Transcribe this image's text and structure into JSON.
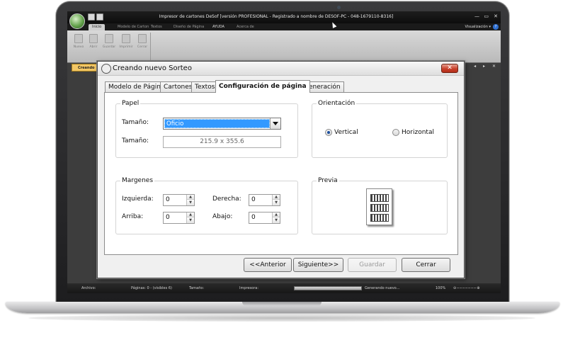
{
  "app": {
    "title": "Impresor de cartones DeSof [versión PROFESIONAL  - Registrado a nombre de DESOF-PC - 048-1679110-8316]",
    "window_controls": {
      "minimize": "—",
      "maximize": "▭",
      "close": "✕"
    }
  },
  "ribbon": {
    "tabs": [
      "Inicio",
      "Modelo de Carton",
      "Textos",
      "Diseño de Página",
      "AYUDA",
      "Acerca de"
    ],
    "active_tab": "Inicio",
    "visualizacion_label": "Visualización ▾",
    "help_label": "?",
    "buttons": [
      {
        "label": "Nuevo",
        "icon": "new-doc-icon"
      },
      {
        "label": "Abrir",
        "icon": "open-folder-icon"
      },
      {
        "label": "Guardar",
        "icon": "save-icon"
      },
      {
        "label": "Imprimir",
        "icon": "print-icon"
      },
      {
        "label": "Cerrar",
        "icon": "close-doc-icon"
      }
    ]
  },
  "document_tab": {
    "label": "Creando",
    "controls": "◂ ▸ ✕"
  },
  "dialog": {
    "title": "Creando nuevo Sorteo",
    "close_label": "✕",
    "tabs": [
      "Modelo de Página",
      "Cartones",
      "Textos",
      "Configuración de página",
      "Generación"
    ],
    "active_tab": "Configuración de página",
    "papel": {
      "group_title": "Papel",
      "size_label": "Tamaño:",
      "size_value": "Oficio",
      "dimension_label": "Tamaño:",
      "dimension_value": "215.9 x 355.6"
    },
    "orientacion": {
      "group_title": "Orientación",
      "vertical_label": "Vertical",
      "horizontal_label": "Horizontal",
      "selected": "Vertical"
    },
    "margenes": {
      "group_title": "Margenes",
      "izquierda_label": "Izquierda:",
      "izquierda_value": "0",
      "derecha_label": "Derecha:",
      "derecha_value": "0",
      "arriba_label": "Arriba:",
      "arriba_value": "0",
      "abajo_label": "Abajo:",
      "abajo_value": "0"
    },
    "previa": {
      "group_title": "Previa"
    },
    "buttons": {
      "anterior": "<<Anterior",
      "siguiente": "Siguiente>>",
      "guardar": "Guardar",
      "cerrar": "Cerrar"
    }
  },
  "statusbar": {
    "archivo": "Archivo:",
    "paginas": "Páginas: 0 - (visibles 6)",
    "tamano": "Tamaño:",
    "impresora": "Impresora:",
    "generando": "Generando nuevo...",
    "zoom": "100%"
  },
  "colors": {
    "selection": "#3399ff",
    "doc_tab": "#f3c765",
    "close_button": "#c8402a",
    "titlebar": "#111111"
  }
}
